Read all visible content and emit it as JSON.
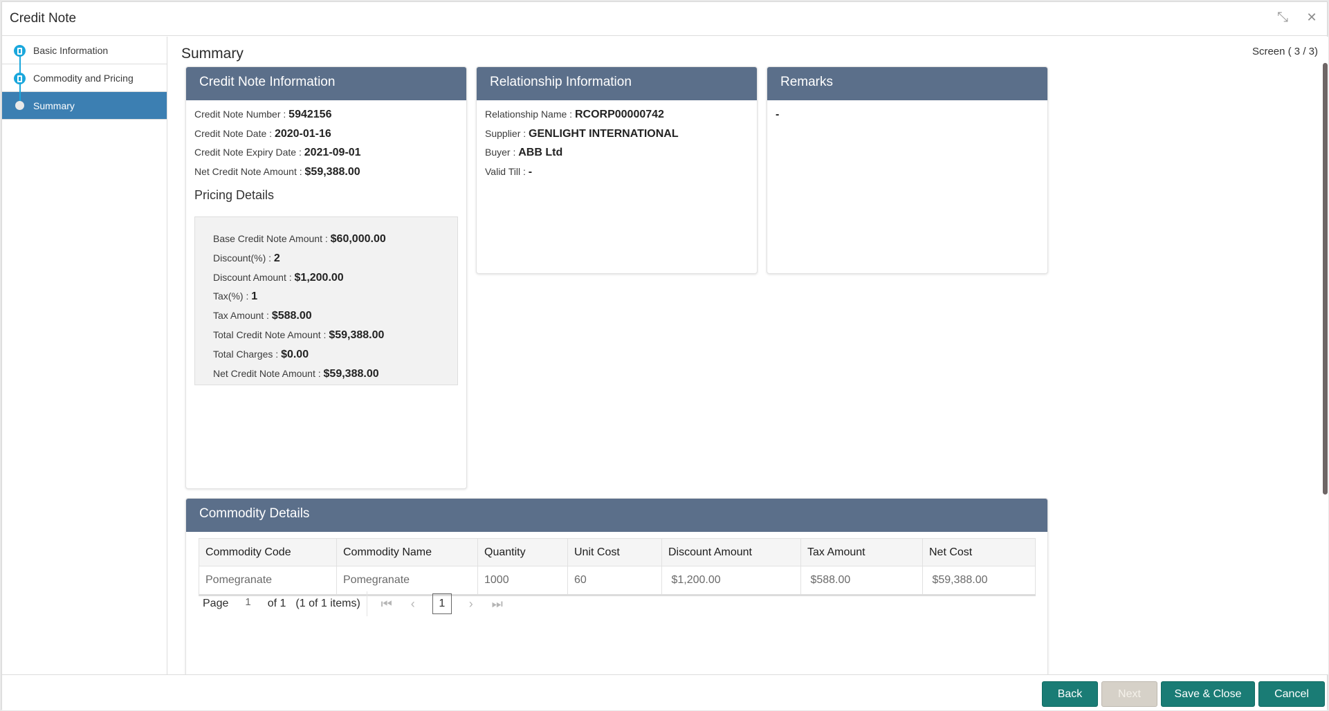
{
  "window": {
    "title": "Credit Note",
    "controls": {
      "minimize_icon": "compress-arrows-icon",
      "close_icon": "close-icon",
      "minimize_glyph": "⤡",
      "close_glyph": "✕"
    }
  },
  "sidebar": {
    "steps": [
      {
        "label": "Basic Information",
        "state": "completed"
      },
      {
        "label": "Commodity and Pricing",
        "state": "completed"
      },
      {
        "label": "Summary",
        "state": "active"
      }
    ]
  },
  "main": {
    "title": "Summary",
    "screen_indicator": "Screen ( 3 / 3)",
    "credit_note_info": {
      "header": "Credit Note Information",
      "fields": [
        {
          "label": "Credit Note Number",
          "value": "5942156"
        },
        {
          "label": "Credit Note Date",
          "value": "2020-01-16"
        },
        {
          "label": "Credit Note Expiry Date",
          "value": "2021-09-01"
        },
        {
          "label": "Net Credit Note Amount",
          "value": "$59,388.00"
        }
      ],
      "pricing_title": "Pricing Details",
      "pricing": [
        {
          "label": "Base Credit Note Amount",
          "value": "$60,000.00"
        },
        {
          "label": "Discount(%)",
          "value": "2"
        },
        {
          "label": "Discount Amount",
          "value": "$1,200.00"
        },
        {
          "label": "Tax(%)",
          "value": "1"
        },
        {
          "label": "Tax Amount",
          "value": "$588.00"
        },
        {
          "label": "Total Credit Note Amount",
          "value": "$59,388.00"
        },
        {
          "label": "Total Charges",
          "value": "$0.00"
        },
        {
          "label": "Net Credit Note Amount",
          "value": "$59,388.00"
        }
      ]
    },
    "relationship_info": {
      "header": "Relationship Information",
      "fields": [
        {
          "label": "Relationship Name",
          "value": "RCORP00000742"
        },
        {
          "label": "Supplier",
          "value": "GENLIGHT INTERNATIONAL"
        },
        {
          "label": "Buyer",
          "value": "ABB Ltd"
        },
        {
          "label": "Valid Till",
          "value": "-"
        }
      ]
    },
    "remarks": {
      "header": "Remarks",
      "value": "-"
    },
    "commodity_details": {
      "header": "Commodity Details",
      "columns": [
        "Commodity Code",
        "Commodity Name",
        "Quantity",
        "Unit Cost",
        "Discount Amount",
        "Tax Amount",
        "Net Cost"
      ],
      "rows": [
        [
          "Pomegranate",
          "Pomegranate",
          "1000",
          "60",
          " $1,200.00",
          " $588.00",
          " $59,388.00"
        ]
      ],
      "pager": {
        "page_label": "Page",
        "page_value": "1",
        "of_label": "of 1",
        "items_label": "(1 of 1 items)",
        "current": "1",
        "first_glyph": "K",
        "prev_glyph": "‹",
        "next_glyph": "›",
        "last_glyph": "›|"
      }
    }
  },
  "footer": {
    "back": "Back",
    "next": "Next",
    "save_close": "Save & Close",
    "cancel": "Cancel"
  },
  "colors": {
    "card_header": "#5b6f8a",
    "active_step": "#3c7fb2",
    "step_dot": "#1aa7dc",
    "primary_button": "#1a7c75",
    "disabled_button": "#d6d1c8"
  }
}
